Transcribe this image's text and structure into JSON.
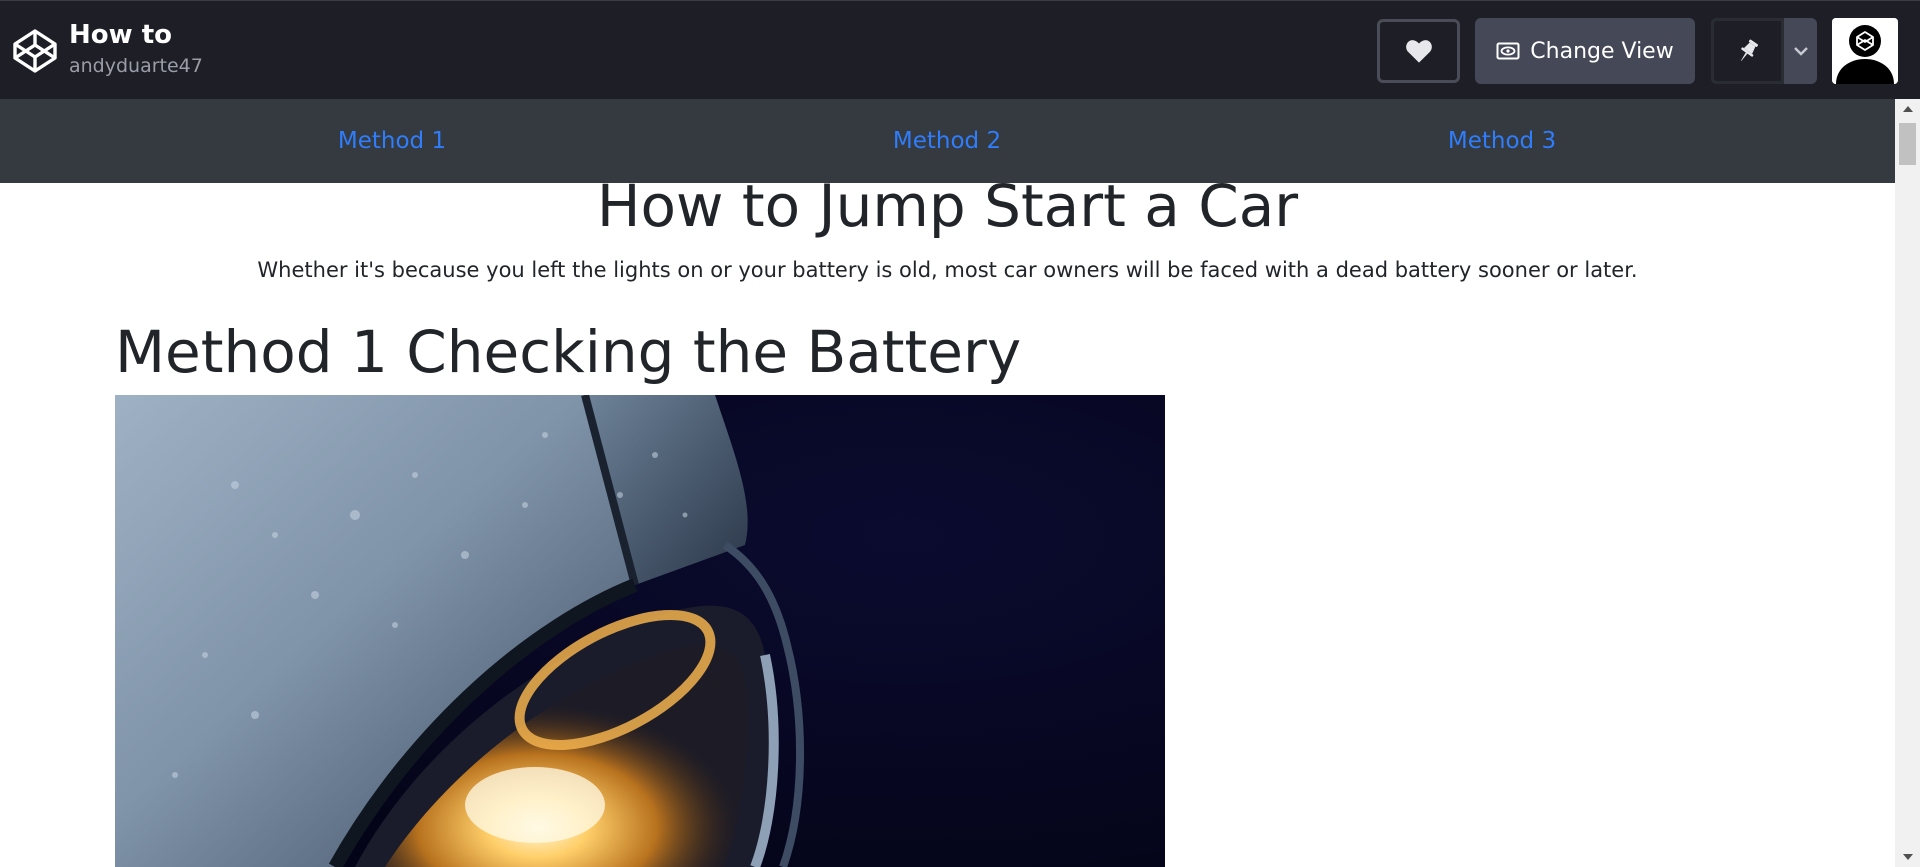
{
  "header": {
    "title": "How to",
    "author": "andyduarte47",
    "change_view_label": "Change View",
    "icons": [
      "codepen-logo-icon",
      "heart-icon",
      "eye-icon",
      "pin-icon",
      "chevron-down-icon",
      "avatar"
    ]
  },
  "page": {
    "nav": [
      "Method 1",
      "Method 2",
      "Method 3"
    ],
    "title": "How to Jump Start a Car",
    "lead": "Whether it's because you left the lights on or your battery is old, most car owners will be faced with a dead battery sooner or later.",
    "method_heading": "Method 1 Checking the Battery"
  },
  "colors": {
    "topbar": "#1e1f26",
    "button": "#444857",
    "navbar": "#343a40",
    "link": "#2f7dfa",
    "text": "#212529"
  }
}
